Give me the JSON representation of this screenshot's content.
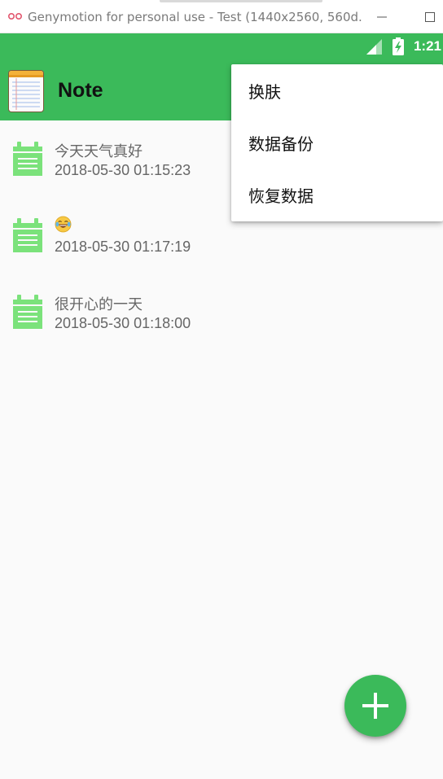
{
  "window": {
    "title": "Genymotion for personal use - Test (1440x2560, 560d..."
  },
  "status_bar": {
    "time": "1:21",
    "icons": [
      "signal-icon",
      "battery-charging-icon"
    ]
  },
  "app_bar": {
    "title": "Note",
    "logo_icon": "notepad-icon"
  },
  "menu": {
    "items": [
      {
        "label": "换肤"
      },
      {
        "label": "数据备份"
      },
      {
        "label": "恢复数据"
      }
    ]
  },
  "notes": [
    {
      "title": "今天天气真好",
      "date": "2018-05-30 01:15:23",
      "icon": "calendar-icon"
    },
    {
      "title": "",
      "emoji": "laughing-tears-emoji",
      "date": "2018-05-30 01:17:19",
      "icon": "calendar-icon"
    },
    {
      "title": "很开心的一天",
      "date": "2018-05-30 01:18:00",
      "icon": "calendar-icon"
    }
  ],
  "fab": {
    "icon": "plus-icon"
  },
  "colors": {
    "primary": "#3bba5a",
    "calendar_icon": "#7be27b",
    "background": "#fafafa",
    "text_secondary": "#666666"
  }
}
